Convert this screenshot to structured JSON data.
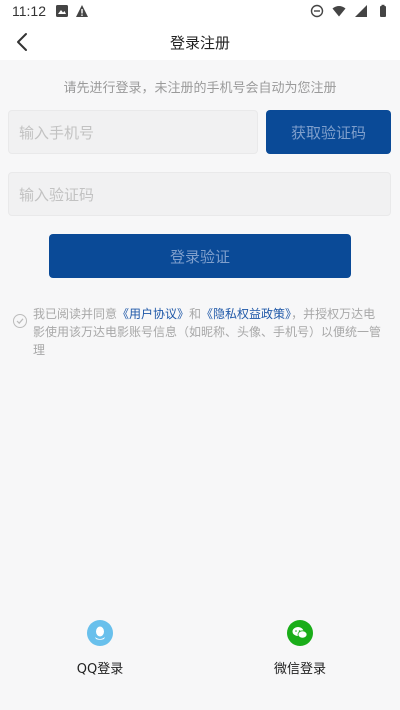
{
  "status_bar": {
    "time": "11:12",
    "left_icons": [
      "gallery-icon",
      "warning-icon"
    ],
    "right_icons": [
      "dnd-icon",
      "wifi-icon",
      "signal-icon",
      "battery-icon"
    ]
  },
  "navbar": {
    "back_icon": "chevron-left-icon",
    "title": "登录注册"
  },
  "form": {
    "hint": "请先进行登录，未注册的手机号会自动为您注册",
    "phone_placeholder": "输入手机号",
    "get_code_label": "获取验证码",
    "code_placeholder": "输入验证码",
    "login_label": "登录验证"
  },
  "agreement": {
    "prefix": "我已阅读并同意",
    "user_agreement": "《用户协议》",
    "and": "和",
    "privacy_policy": "《隐私权益政策》",
    "suffix": "，并授权万达电影使用该万达电影账号信息（如昵称、头像、手机号）以便统一管理"
  },
  "social_login": {
    "qq_label": "QQ登录",
    "wechat_label": "微信登录"
  },
  "colors": {
    "primary": "#0a4a97",
    "link": "#1f58a8",
    "qq": "#69c0ec",
    "wechat": "#1aad19"
  }
}
